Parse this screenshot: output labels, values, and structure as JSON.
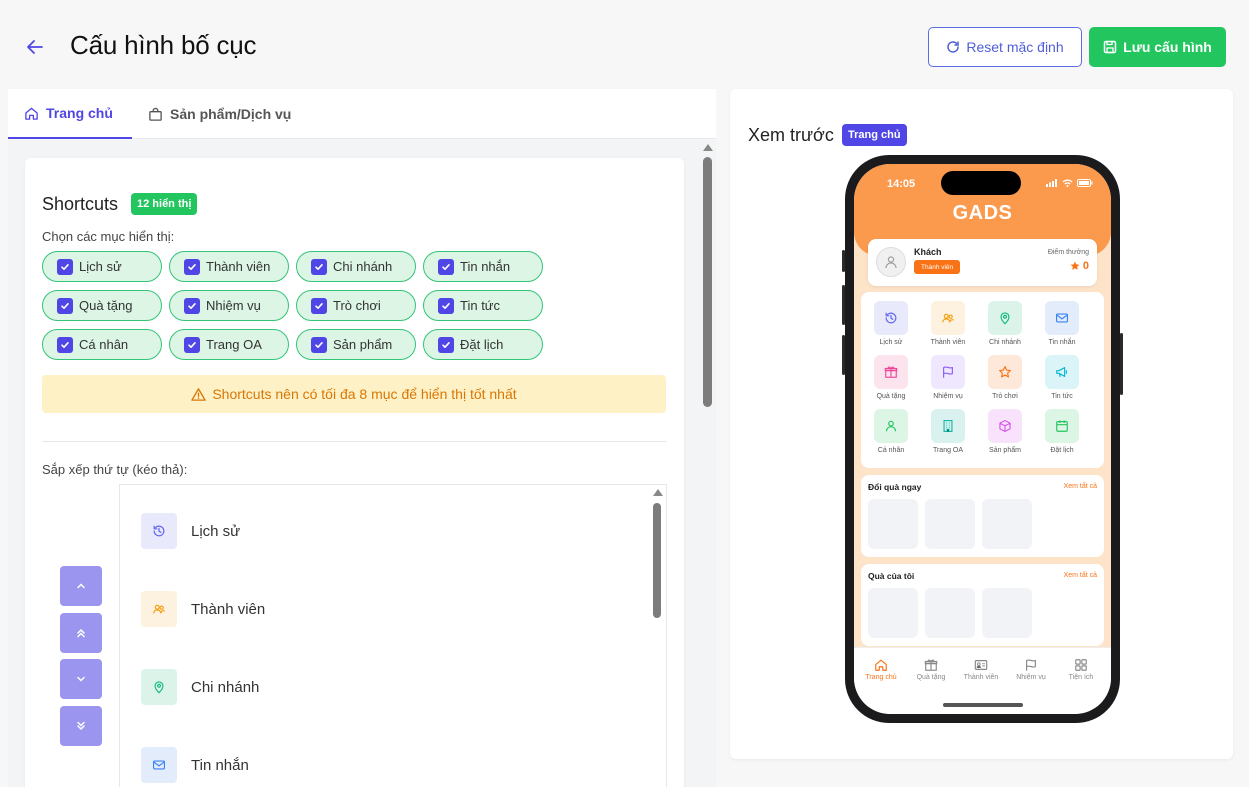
{
  "header": {
    "title": "Cấu hình bố cục",
    "reset_label": "Reset mặc định",
    "save_label": "Lưu cấu hình"
  },
  "tabs": [
    {
      "label": "Trang chủ",
      "active": true
    },
    {
      "label": "Sản phẩm/Dịch vụ",
      "active": false
    }
  ],
  "shortcuts": {
    "title": "Shortcuts",
    "count_badge": "12 hiển thị",
    "choose_label": "Chọn các mục hiển thị:",
    "chips": [
      {
        "label": "Lịch sử",
        "checked": true
      },
      {
        "label": "Thành viên",
        "checked": true
      },
      {
        "label": "Chi nhánh",
        "checked": true
      },
      {
        "label": "Tin nhắn",
        "checked": true
      },
      {
        "label": "Quà tặng",
        "checked": true
      },
      {
        "label": "Nhiệm vụ",
        "checked": true
      },
      {
        "label": "Trò chơi",
        "checked": true
      },
      {
        "label": "Tin tức",
        "checked": true
      },
      {
        "label": "Cá nhân",
        "checked": true
      },
      {
        "label": "Trang OA",
        "checked": true
      },
      {
        "label": "Sản phẩm",
        "checked": true
      },
      {
        "label": "Đặt lịch",
        "checked": true
      }
    ],
    "warning": "Shortcuts nên có tối đa 8 mục để hiển thị tốt nhất",
    "sort_label": "Sắp xếp thứ tự (kéo thả):",
    "sort_items": [
      {
        "label": "Lịch sử",
        "icon": "history-icon"
      },
      {
        "label": "Thành viên",
        "icon": "users-icon"
      },
      {
        "label": "Chi nhánh",
        "icon": "map-pin-icon"
      },
      {
        "label": "Tin nhắn",
        "icon": "mail-icon"
      }
    ]
  },
  "preview": {
    "title": "Xem trước",
    "badge": "Trang chủ",
    "phone": {
      "time": "14:05",
      "app_title": "GADS",
      "user_name": "Khách",
      "member_badge": "Thành viên",
      "points_label": "Điểm thưởng",
      "points_value": "0",
      "grid": [
        "Lịch sử",
        "Thành viên",
        "Chi nhánh",
        "Tin nhắn",
        "Quà tặng",
        "Nhiệm vụ",
        "Trò chơi",
        "Tin tức",
        "Cá nhân",
        "Trang OA",
        "Sản phẩm",
        "Đặt lịch"
      ],
      "section1_title": "Đổi quà ngay",
      "section2_title": "Quà của tôi",
      "see_all": "Xem tất cả",
      "bottom_nav": [
        "Trang chủ",
        "Quà tặng",
        "Thành viên",
        "Nhiệm vụ",
        "Tiện ích"
      ]
    }
  },
  "colors": {
    "primary": "#4f46e5",
    "success": "#22c55e",
    "warning": "#d97706",
    "accent_orange": "#f97316"
  }
}
